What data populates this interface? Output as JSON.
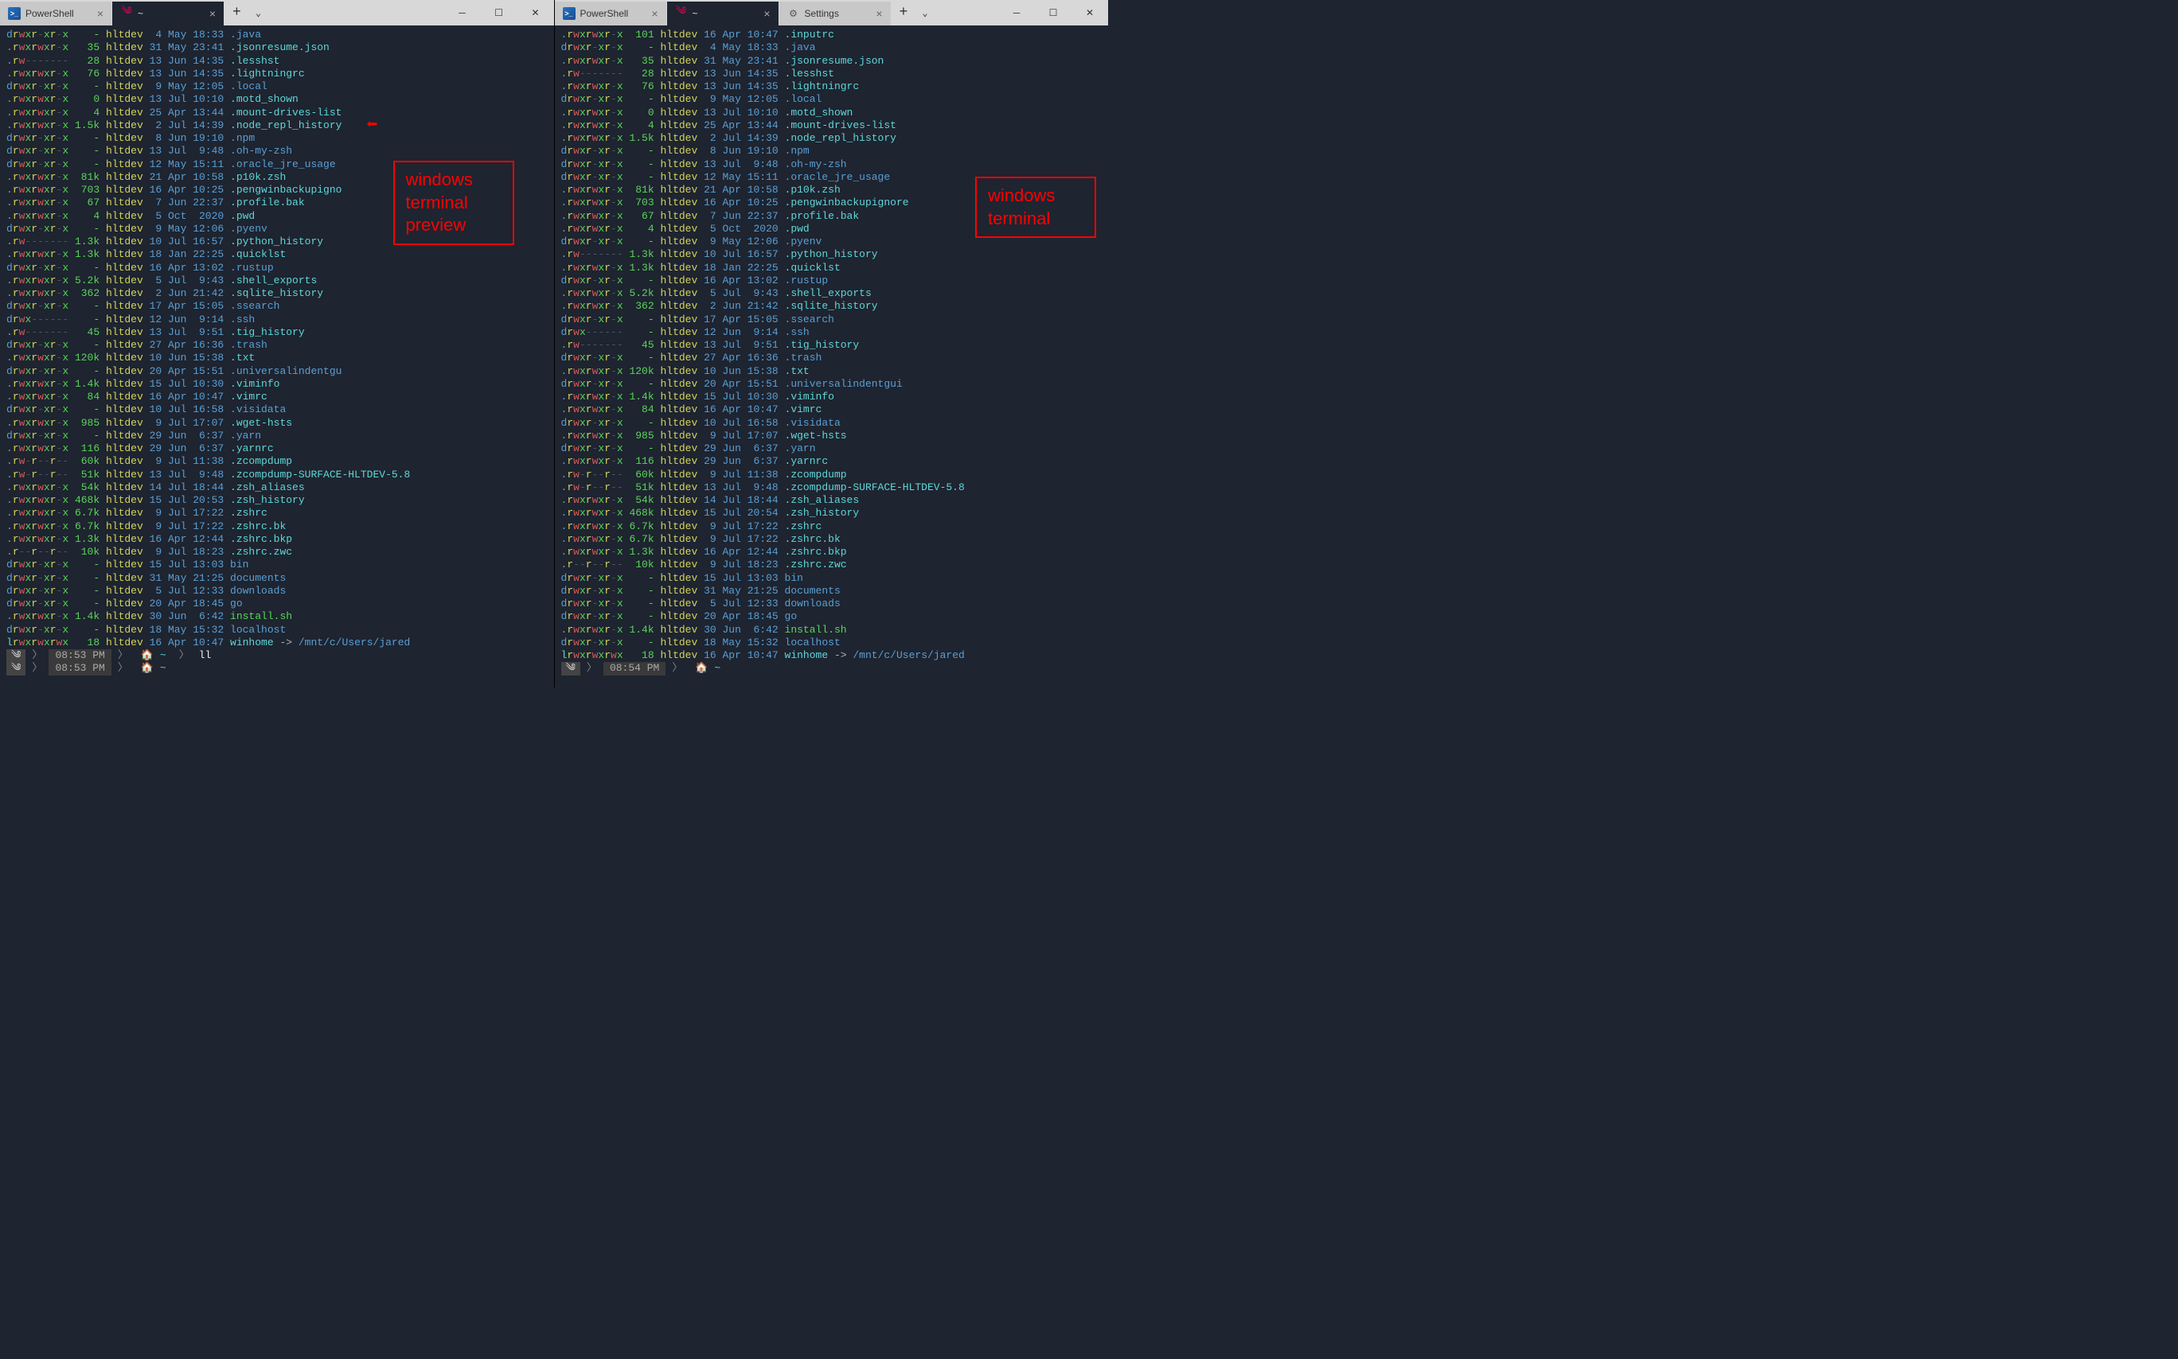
{
  "left": {
    "tabs": [
      {
        "icon": "ps",
        "label": "PowerShell"
      },
      {
        "icon": "debian",
        "label": "~"
      }
    ],
    "annotation": "windows\nterminal\npreview",
    "prompt1_time": "08:53 PM",
    "prompt1_path": "~",
    "prompt1_cmd": "ll",
    "prompt2_time": "08:53 PM",
    "prompt2_path": "~",
    "rows": [
      {
        "perm": "drwxr-xr-x",
        "size": "-",
        "user": "hltdev",
        "date": " 4 May 18:33",
        "name": ".java",
        "cls": "dir"
      },
      {
        "perm": ".rwxrwxr-x",
        "size": "35",
        "user": "hltdev",
        "date": "31 May 23:41",
        "name": ".jsonresume.json",
        "cls": "file"
      },
      {
        "perm": ".rw-------",
        "size": "28",
        "user": "hltdev",
        "date": "13 Jun 14:35",
        "name": ".lesshst",
        "cls": "file"
      },
      {
        "perm": ".rwxrwxr-x",
        "size": "76",
        "user": "hltdev",
        "date": "13 Jun 14:35",
        "name": ".lightningrc",
        "cls": "file",
        "trunc": true
      },
      {
        "perm": "drwxr-xr-x",
        "size": "-",
        "user": "hltdev",
        "date": " 9 May 12:05",
        "name": ".local",
        "cls": "dir"
      },
      {
        "perm": ".rwxrwxr-x",
        "size": "0",
        "user": "hltdev",
        "date": "13 Jul 10:10",
        "name": ".motd_shown",
        "cls": "file",
        "trunc": true
      },
      {
        "perm": ".rwxrwxr-x",
        "size": "4",
        "user": "hltdev",
        "date": "25 Apr 13:44",
        "name": ".mount-drives-list",
        "cls": "file",
        "trunc": true
      },
      {
        "perm": ".rwxrwxr-x",
        "size": "1.5k",
        "user": "hltdev",
        "date": " 2 Jul 14:39",
        "name": ".node_repl_history",
        "cls": "file",
        "trunc": true
      },
      {
        "perm": "drwxr-xr-x",
        "size": "-",
        "user": "hltdev",
        "date": " 8 Jun 19:10",
        "name": ".npm",
        "cls": "dir"
      },
      {
        "perm": "drwxr-xr-x",
        "size": "-",
        "user": "hltdev",
        "date": "13 Jul  9:48",
        "name": ".oh-my-zsh",
        "cls": "dir",
        "trunc": true
      },
      {
        "perm": "drwxr-xr-x",
        "size": "-",
        "user": "hltdev",
        "date": "12 May 15:11",
        "name": ".oracle_jre_usage",
        "cls": "dir",
        "trunc": true
      },
      {
        "perm": ".rwxrwxr-x",
        "size": "81k",
        "user": "hltdev",
        "date": "21 Apr 10:58",
        "name": ".p10k.zsh",
        "cls": "file",
        "trunc": true
      },
      {
        "perm": ".rwxrwxr-x",
        "size": "703",
        "user": "hltdev",
        "date": "16 Apr 10:25",
        "name": ".pengwinbackupignore",
        "cls": "file",
        "trunc": true
      },
      {
        "perm": ".rwxrwxr-x",
        "size": "67",
        "user": "hltdev",
        "date": " 7 Jun 22:37",
        "name": ".profile.bak",
        "cls": "file",
        "trunc": true
      },
      {
        "perm": ".rwxrwxr-x",
        "size": "4",
        "user": "hltdev",
        "date": " 5 Oct  2020",
        "name": ".pwd",
        "cls": "file"
      },
      {
        "perm": "drwxr-xr-x",
        "size": "-",
        "user": "hltdev",
        "date": " 9 May 12:06",
        "name": ".pyenv",
        "cls": "dir"
      },
      {
        "perm": ".rw-------",
        "size": "1.3k",
        "user": "hltdev",
        "date": "10 Jul 16:57",
        "name": ".python_history",
        "cls": "file"
      },
      {
        "perm": ".rwxrwxr-x",
        "size": "1.3k",
        "user": "hltdev",
        "date": "18 Jan 22:25",
        "name": ".quicklst",
        "cls": "file",
        "trunc": true
      },
      {
        "perm": "drwxr-xr-x",
        "size": "-",
        "user": "hltdev",
        "date": "16 Apr 13:02",
        "name": ".rustup",
        "cls": "dir"
      },
      {
        "perm": ".rwxrwxr-x",
        "size": "5.2k",
        "user": "hltdev",
        "date": " 5 Jul  9:43",
        "name": ".shell_exports",
        "cls": "file",
        "trunc": true
      },
      {
        "perm": ".rwxrwxr-x",
        "size": "362",
        "user": "hltdev",
        "date": " 2 Jun 21:42",
        "name": ".sqlite_history",
        "cls": "file",
        "trunc": true
      },
      {
        "perm": "drwxr-xr-x",
        "size": "-",
        "user": "hltdev",
        "date": "17 Apr 15:05",
        "name": ".ssearch",
        "cls": "dir",
        "trunc": true
      },
      {
        "perm": "drwx------",
        "size": "-",
        "user": "hltdev",
        "date": "12 Jun  9:14",
        "name": ".ssh",
        "cls": "dir"
      },
      {
        "perm": ".rw-------",
        "size": "45",
        "user": "hltdev",
        "date": "13 Jul  9:51",
        "name": ".tig_history",
        "cls": "file"
      },
      {
        "perm": "drwxr-xr-x",
        "size": "-",
        "user": "hltdev",
        "date": "27 Apr 16:36",
        "name": ".trash",
        "cls": "dir"
      },
      {
        "perm": ".rwxrwxr-x",
        "size": "120k",
        "user": "hltdev",
        "date": "10 Jun 15:38",
        "name": ".txt",
        "cls": "file"
      },
      {
        "perm": "drwxr-xr-x",
        "size": "-",
        "user": "hltdev",
        "date": "20 Apr 15:51",
        "name": ".universalindentgui",
        "cls": "dir",
        "trunc": true
      },
      {
        "perm": ".rwxrwxr-x",
        "size": "1.4k",
        "user": "hltdev",
        "date": "15 Jul 10:30",
        "name": ".viminfo",
        "cls": "file",
        "trunc": true
      },
      {
        "perm": ".rwxrwxr-x",
        "size": "84",
        "user": "hltdev",
        "date": "16 Apr 10:47",
        "name": ".vimrc",
        "cls": "file"
      },
      {
        "perm": "drwxr-xr-x",
        "size": "-",
        "user": "hltdev",
        "date": "10 Jul 16:58",
        "name": ".visidata",
        "cls": "dir",
        "trunc": true
      },
      {
        "perm": ".rwxrwxr-x",
        "size": "985",
        "user": "hltdev",
        "date": " 9 Jul 17:07",
        "name": ".wget-hsts",
        "cls": "file",
        "trunc": true
      },
      {
        "perm": "drwxr-xr-x",
        "size": "-",
        "user": "hltdev",
        "date": "29 Jun  6:37",
        "name": ".yarn",
        "cls": "dir"
      },
      {
        "perm": ".rwxrwxr-x",
        "size": "116",
        "user": "hltdev",
        "date": "29 Jun  6:37",
        "name": ".yarnrc",
        "cls": "file"
      },
      {
        "perm": ".rw-r--r--",
        "size": "60k",
        "user": "hltdev",
        "date": " 9 Jul 11:38",
        "name": ".zcompdump",
        "cls": "file"
      },
      {
        "perm": ".rw-r--r--",
        "size": "51k",
        "user": "hltdev",
        "date": "13 Jul  9:48",
        "name": ".zcompdump-SURFACE-HLTDEV-5.8",
        "cls": "file"
      },
      {
        "perm": ".rwxrwxr-x",
        "size": "54k",
        "user": "hltdev",
        "date": "14 Jul 18:44",
        "name": ".zsh_aliases",
        "cls": "file",
        "trunc": true
      },
      {
        "perm": ".rwxrwxr-x",
        "size": "468k",
        "user": "hltdev",
        "date": "15 Jul 20:53",
        "name": ".zsh_history",
        "cls": "file",
        "trunc": true
      },
      {
        "perm": ".rwxrwxr-x",
        "size": "6.7k",
        "user": "hltdev",
        "date": " 9 Jul 17:22",
        "name": ".zshrc",
        "cls": "file",
        "trunc": true
      },
      {
        "perm": ".rwxrwxr-x",
        "size": "6.7k",
        "user": "hltdev",
        "date": " 9 Jul 17:22",
        "name": ".zshrc.bk",
        "cls": "file",
        "trunc": true
      },
      {
        "perm": ".rwxrwxr-x",
        "size": "1.3k",
        "user": "hltdev",
        "date": "16 Apr 12:44",
        "name": ".zshrc.bkp",
        "cls": "file",
        "trunc": true
      },
      {
        "perm": ".r--r--r--",
        "size": "10k",
        "user": "hltdev",
        "date": " 9 Jul 18:23",
        "name": ".zshrc.zwc",
        "cls": "file",
        "trunc": true
      },
      {
        "perm": "drwxr-xr-x",
        "size": "-",
        "user": "hltdev",
        "date": "15 Jul 13:03",
        "name": "bin",
        "cls": "dir"
      },
      {
        "perm": "drwxr-xr-x",
        "size": "-",
        "user": "hltdev",
        "date": "31 May 21:25",
        "name": "documents",
        "cls": "dir",
        "trunc": true
      },
      {
        "perm": "drwxr-xr-x",
        "size": "-",
        "user": "hltdev",
        "date": " 5 Jul 12:33",
        "name": "downloads",
        "cls": "dir",
        "trunc": true
      },
      {
        "perm": "drwxr-xr-x",
        "size": "-",
        "user": "hltdev",
        "date": "20 Apr 18:45",
        "name": "go",
        "cls": "dir"
      },
      {
        "perm": ".rwxrwxr-x",
        "size": "1.4k",
        "user": "hltdev",
        "date": "30 Jun  6:42",
        "name": "install.sh",
        "cls": "exec",
        "trunc": true
      },
      {
        "perm": "drwxr-xr-x",
        "size": "-",
        "user": "hltdev",
        "date": "18 May 15:32",
        "name": "localhost",
        "cls": "dir",
        "trunc": true
      },
      {
        "perm": "lrwxrwxrwx",
        "size": "18",
        "user": "hltdev",
        "date": "16 Apr 10:47",
        "name": "winhome -> /mnt/c/Users/jared",
        "cls": "link"
      }
    ]
  },
  "right": {
    "tabs": [
      {
        "icon": "ps",
        "label": "PowerShell"
      },
      {
        "icon": "debian",
        "label": "~"
      },
      {
        "icon": "settings",
        "label": "Settings"
      }
    ],
    "annotation": "windows\nterminal",
    "prompt1_time": "08:54 PM",
    "prompt1_path": "~",
    "rows": [
      {
        "perm": ".rwxrwxr-x",
        "size": "101",
        "user": "hltdev",
        "date": "16 Apr 10:47",
        "name": ".inputrc",
        "cls": "file"
      },
      {
        "perm": "drwxr-xr-x",
        "size": "-",
        "user": "hltdev",
        "date": " 4 May 18:33",
        "name": ".java",
        "cls": "dir"
      },
      {
        "perm": ".rwxrwxr-x",
        "size": "35",
        "user": "hltdev",
        "date": "31 May 23:41",
        "name": ".jsonresume.json",
        "cls": "file"
      },
      {
        "perm": ".rw-------",
        "size": "28",
        "user": "hltdev",
        "date": "13 Jun 14:35",
        "name": ".lesshst",
        "cls": "file"
      },
      {
        "perm": ".rwxrwxr-x",
        "size": "76",
        "user": "hltdev",
        "date": "13 Jun 14:35",
        "name": ".lightningrc",
        "cls": "file"
      },
      {
        "perm": "drwxr-xr-x",
        "size": "-",
        "user": "hltdev",
        "date": " 9 May 12:05",
        "name": ".local",
        "cls": "dir"
      },
      {
        "perm": ".rwxrwxr-x",
        "size": "0",
        "user": "hltdev",
        "date": "13 Jul 10:10",
        "name": ".motd_shown",
        "cls": "file"
      },
      {
        "perm": ".rwxrwxr-x",
        "size": "4",
        "user": "hltdev",
        "date": "25 Apr 13:44",
        "name": ".mount-drives-list",
        "cls": "file"
      },
      {
        "perm": ".rwxrwxr-x",
        "size": "1.5k",
        "user": "hltdev",
        "date": " 2 Jul 14:39",
        "name": ".node_repl_history",
        "cls": "file"
      },
      {
        "perm": "drwxr-xr-x",
        "size": "-",
        "user": "hltdev",
        "date": " 8 Jun 19:10",
        "name": ".npm",
        "cls": "dir"
      },
      {
        "perm": "drwxr-xr-x",
        "size": "-",
        "user": "hltdev",
        "date": "13 Jul  9:48",
        "name": ".oh-my-zsh",
        "cls": "dir"
      },
      {
        "perm": "drwxr-xr-x",
        "size": "-",
        "user": "hltdev",
        "date": "12 May 15:11",
        "name": ".oracle_jre_usage",
        "cls": "dir"
      },
      {
        "perm": ".rwxrwxr-x",
        "size": "81k",
        "user": "hltdev",
        "date": "21 Apr 10:58",
        "name": ".p10k.zsh",
        "cls": "file"
      },
      {
        "perm": ".rwxrwxr-x",
        "size": "703",
        "user": "hltdev",
        "date": "16 Apr 10:25",
        "name": ".pengwinbackupignore",
        "cls": "file"
      },
      {
        "perm": ".rwxrwxr-x",
        "size": "67",
        "user": "hltdev",
        "date": " 7 Jun 22:37",
        "name": ".profile.bak",
        "cls": "file"
      },
      {
        "perm": ".rwxrwxr-x",
        "size": "4",
        "user": "hltdev",
        "date": " 5 Oct  2020",
        "name": ".pwd",
        "cls": "file"
      },
      {
        "perm": "drwxr-xr-x",
        "size": "-",
        "user": "hltdev",
        "date": " 9 May 12:06",
        "name": ".pyenv",
        "cls": "dir"
      },
      {
        "perm": ".rw-------",
        "size": "1.3k",
        "user": "hltdev",
        "date": "10 Jul 16:57",
        "name": ".python_history",
        "cls": "file"
      },
      {
        "perm": ".rwxrwxr-x",
        "size": "1.3k",
        "user": "hltdev",
        "date": "18 Jan 22:25",
        "name": ".quicklst",
        "cls": "file"
      },
      {
        "perm": "drwxr-xr-x",
        "size": "-",
        "user": "hltdev",
        "date": "16 Apr 13:02",
        "name": ".rustup",
        "cls": "dir"
      },
      {
        "perm": ".rwxrwxr-x",
        "size": "5.2k",
        "user": "hltdev",
        "date": " 5 Jul  9:43",
        "name": ".shell_exports",
        "cls": "file"
      },
      {
        "perm": ".rwxrwxr-x",
        "size": "362",
        "user": "hltdev",
        "date": " 2 Jun 21:42",
        "name": ".sqlite_history",
        "cls": "file"
      },
      {
        "perm": "drwxr-xr-x",
        "size": "-",
        "user": "hltdev",
        "date": "17 Apr 15:05",
        "name": ".ssearch",
        "cls": "dir"
      },
      {
        "perm": "drwx------",
        "size": "-",
        "user": "hltdev",
        "date": "12 Jun  9:14",
        "name": ".ssh",
        "cls": "dir"
      },
      {
        "perm": ".rw-------",
        "size": "45",
        "user": "hltdev",
        "date": "13 Jul  9:51",
        "name": ".tig_history",
        "cls": "file"
      },
      {
        "perm": "drwxr-xr-x",
        "size": "-",
        "user": "hltdev",
        "date": "27 Apr 16:36",
        "name": ".trash",
        "cls": "dir"
      },
      {
        "perm": ".rwxrwxr-x",
        "size": "120k",
        "user": "hltdev",
        "date": "10 Jun 15:38",
        "name": ".txt",
        "cls": "file"
      },
      {
        "perm": "drwxr-xr-x",
        "size": "-",
        "user": "hltdev",
        "date": "20 Apr 15:51",
        "name": ".universalindentgui",
        "cls": "dir"
      },
      {
        "perm": ".rwxrwxr-x",
        "size": "1.4k",
        "user": "hltdev",
        "date": "15 Jul 10:30",
        "name": ".viminfo",
        "cls": "file"
      },
      {
        "perm": ".rwxrwxr-x",
        "size": "84",
        "user": "hltdev",
        "date": "16 Apr 10:47",
        "name": ".vimrc",
        "cls": "file"
      },
      {
        "perm": "drwxr-xr-x",
        "size": "-",
        "user": "hltdev",
        "date": "10 Jul 16:58",
        "name": ".visidata",
        "cls": "dir"
      },
      {
        "perm": ".rwxrwxr-x",
        "size": "985",
        "user": "hltdev",
        "date": " 9 Jul 17:07",
        "name": ".wget-hsts",
        "cls": "file"
      },
      {
        "perm": "drwxr-xr-x",
        "size": "-",
        "user": "hltdev",
        "date": "29 Jun  6:37",
        "name": ".yarn",
        "cls": "dir"
      },
      {
        "perm": ".rwxrwxr-x",
        "size": "116",
        "user": "hltdev",
        "date": "29 Jun  6:37",
        "name": ".yarnrc",
        "cls": "file"
      },
      {
        "perm": ".rw-r--r--",
        "size": "60k",
        "user": "hltdev",
        "date": " 9 Jul 11:38",
        "name": ".zcompdump",
        "cls": "file"
      },
      {
        "perm": ".rw-r--r--",
        "size": "51k",
        "user": "hltdev",
        "date": "13 Jul  9:48",
        "name": ".zcompdump-SURFACE-HLTDEV-5.8",
        "cls": "file"
      },
      {
        "perm": ".rwxrwxr-x",
        "size": "54k",
        "user": "hltdev",
        "date": "14 Jul 18:44",
        "name": ".zsh_aliases",
        "cls": "file"
      },
      {
        "perm": ".rwxrwxr-x",
        "size": "468k",
        "user": "hltdev",
        "date": "15 Jul 20:54",
        "name": ".zsh_history",
        "cls": "file"
      },
      {
        "perm": ".rwxrwxr-x",
        "size": "6.7k",
        "user": "hltdev",
        "date": " 9 Jul 17:22",
        "name": ".zshrc",
        "cls": "file"
      },
      {
        "perm": ".rwxrwxr-x",
        "size": "6.7k",
        "user": "hltdev",
        "date": " 9 Jul 17:22",
        "name": ".zshrc.bk",
        "cls": "file"
      },
      {
        "perm": ".rwxrwxr-x",
        "size": "1.3k",
        "user": "hltdev",
        "date": "16 Apr 12:44",
        "name": ".zshrc.bkp",
        "cls": "file"
      },
      {
        "perm": ".r--r--r--",
        "size": "10k",
        "user": "hltdev",
        "date": " 9 Jul 18:23",
        "name": ".zshrc.zwc",
        "cls": "file"
      },
      {
        "perm": "drwxr-xr-x",
        "size": "-",
        "user": "hltdev",
        "date": "15 Jul 13:03",
        "name": "bin",
        "cls": "dir"
      },
      {
        "perm": "drwxr-xr-x",
        "size": "-",
        "user": "hltdev",
        "date": "31 May 21:25",
        "name": "documents",
        "cls": "dir"
      },
      {
        "perm": "drwxr-xr-x",
        "size": "-",
        "user": "hltdev",
        "date": " 5 Jul 12:33",
        "name": "downloads",
        "cls": "dir"
      },
      {
        "perm": "drwxr-xr-x",
        "size": "-",
        "user": "hltdev",
        "date": "20 Apr 18:45",
        "name": "go",
        "cls": "dir"
      },
      {
        "perm": ".rwxrwxr-x",
        "size": "1.4k",
        "user": "hltdev",
        "date": "30 Jun  6:42",
        "name": "install.sh",
        "cls": "exec"
      },
      {
        "perm": "drwxr-xr-x",
        "size": "-",
        "user": "hltdev",
        "date": "18 May 15:32",
        "name": "localhost",
        "cls": "dir"
      },
      {
        "perm": "lrwxrwxrwx",
        "size": "18",
        "user": "hltdev",
        "date": "16 Apr 10:47",
        "name": "winhome -> /mnt/c/Users/jared",
        "cls": "link"
      }
    ]
  }
}
